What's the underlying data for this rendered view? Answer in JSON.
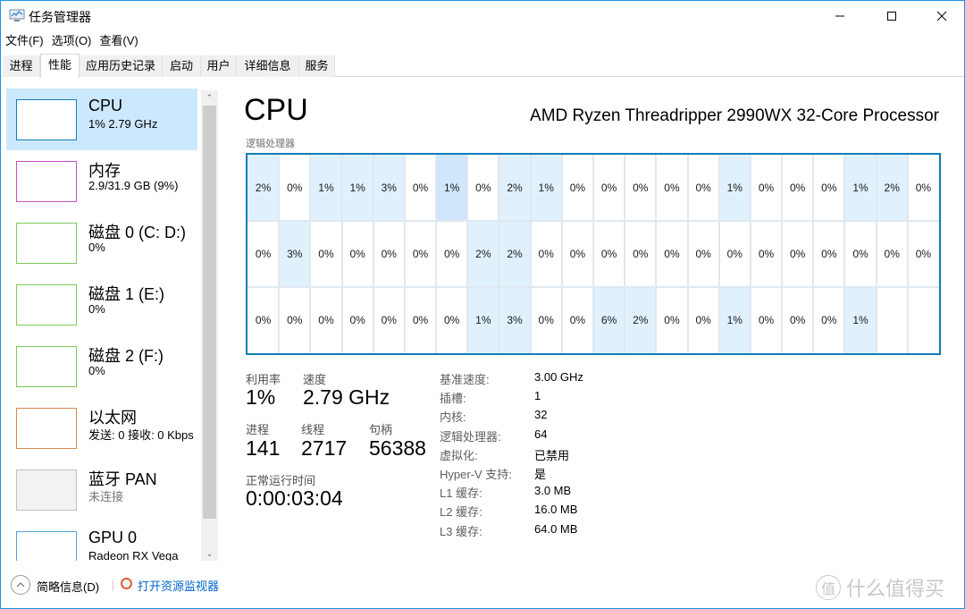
{
  "window": {
    "title": "任务管理器",
    "controls": {
      "minimize": "minimize",
      "maximize": "maximize",
      "close": "close"
    }
  },
  "menu": [
    "文件(F)",
    "选项(O)",
    "查看(V)"
  ],
  "tabs": [
    {
      "label": "进程",
      "active": false
    },
    {
      "label": "性能",
      "active": true
    },
    {
      "label": "应用历史记录",
      "active": false
    },
    {
      "label": "启动",
      "active": false
    },
    {
      "label": "用户",
      "active": false
    },
    {
      "label": "详细信息",
      "active": false
    },
    {
      "label": "服务",
      "active": false
    }
  ],
  "sidebar": {
    "items": [
      {
        "title": "CPU",
        "subtitle": "1% 2.79 GHz",
        "color": "#117dbb",
        "selected": true,
        "muted": false
      },
      {
        "title": "内存",
        "subtitle": "2.9/31.9 GB (9%)",
        "color": "#c74ed0",
        "selected": false,
        "muted": false
      },
      {
        "title": "磁盘 0 (C: D:)",
        "subtitle": "0%",
        "color": "#7fc95a",
        "selected": false,
        "muted": false
      },
      {
        "title": "磁盘 1 (E:)",
        "subtitle": "0%",
        "color": "#7fc95a",
        "selected": false,
        "muted": false
      },
      {
        "title": "磁盘 2 (F:)",
        "subtitle": "0%",
        "color": "#7fc95a",
        "selected": false,
        "muted": false
      },
      {
        "title": "以太网",
        "subtitle": "发送: 0 接收: 0 Kbps",
        "color": "#d9894f",
        "selected": false,
        "muted": true
      },
      {
        "title": "蓝牙 PAN",
        "subtitle": "未连接",
        "color": "#c0c0c0",
        "selected": false,
        "muted": true
      },
      {
        "title": "GPU 0",
        "subtitle": "Radeon RX Vega",
        "color": "#4aa3df",
        "selected": false,
        "muted": false
      }
    ]
  },
  "main": {
    "heading": "CPU",
    "model": "AMD Ryzen Threadripper 2990WX 32-Core Processor",
    "grid_label": "逻辑处理器",
    "logical_processors": [
      "2%",
      "0%",
      "1%",
      "1%",
      "3%",
      "0%",
      "1%",
      "0%",
      "2%",
      "1%",
      "0%",
      "0%",
      "0%",
      "0%",
      "0%",
      "1%",
      "0%",
      "0%",
      "0%",
      "1%",
      "2%",
      "0%",
      "0%",
      "3%",
      "0%",
      "0%",
      "0%",
      "0%",
      "0%",
      "2%",
      "2%",
      "0%",
      "0%",
      "0%",
      "0%",
      "0%",
      "0%",
      "0%",
      "0%",
      "0%",
      "0%",
      "0%",
      "0%",
      "0%",
      "0%",
      "0%",
      "0%",
      "0%",
      "0%",
      "0%",
      "0%",
      "1%",
      "3%",
      "0%",
      "0%",
      "6%",
      "2%",
      "0%",
      "0%",
      "1%",
      "0%",
      "0%",
      "0%",
      "1%"
    ],
    "stats": {
      "utilization_label": "利用率",
      "utilization": "1%",
      "speed_label": "速度",
      "speed": "2.79 GHz",
      "processes_label": "进程",
      "processes": "141",
      "threads_label": "线程",
      "threads": "2717",
      "handles_label": "句柄",
      "handles": "56388",
      "uptime_label": "正常运行时间",
      "uptime": "0:00:03:04"
    },
    "specs": [
      {
        "label": "基准速度:",
        "value": "3.00 GHz"
      },
      {
        "label": "插槽:",
        "value": "1"
      },
      {
        "label": "内核:",
        "value": "32"
      },
      {
        "label": "逻辑处理器:",
        "value": "64"
      },
      {
        "label": "虚拟化:",
        "value": "已禁用"
      },
      {
        "label": "Hyper-V 支持:",
        "value": "是"
      },
      {
        "label": "L1 缓存:",
        "value": "3.0 MB"
      },
      {
        "label": "L2 缓存:",
        "value": "16.0 MB"
      },
      {
        "label": "L3 缓存:",
        "value": "64.0 MB"
      }
    ]
  },
  "footer": {
    "fewer_details": "简略信息(D)",
    "open_resource_monitor": "打开资源监视器"
  },
  "watermark": {
    "badge": "值",
    "text": "什么值得买"
  },
  "colors": {
    "accent": "#117dbb",
    "selected_bg": "#cce8ff",
    "link": "#0066cc"
  }
}
